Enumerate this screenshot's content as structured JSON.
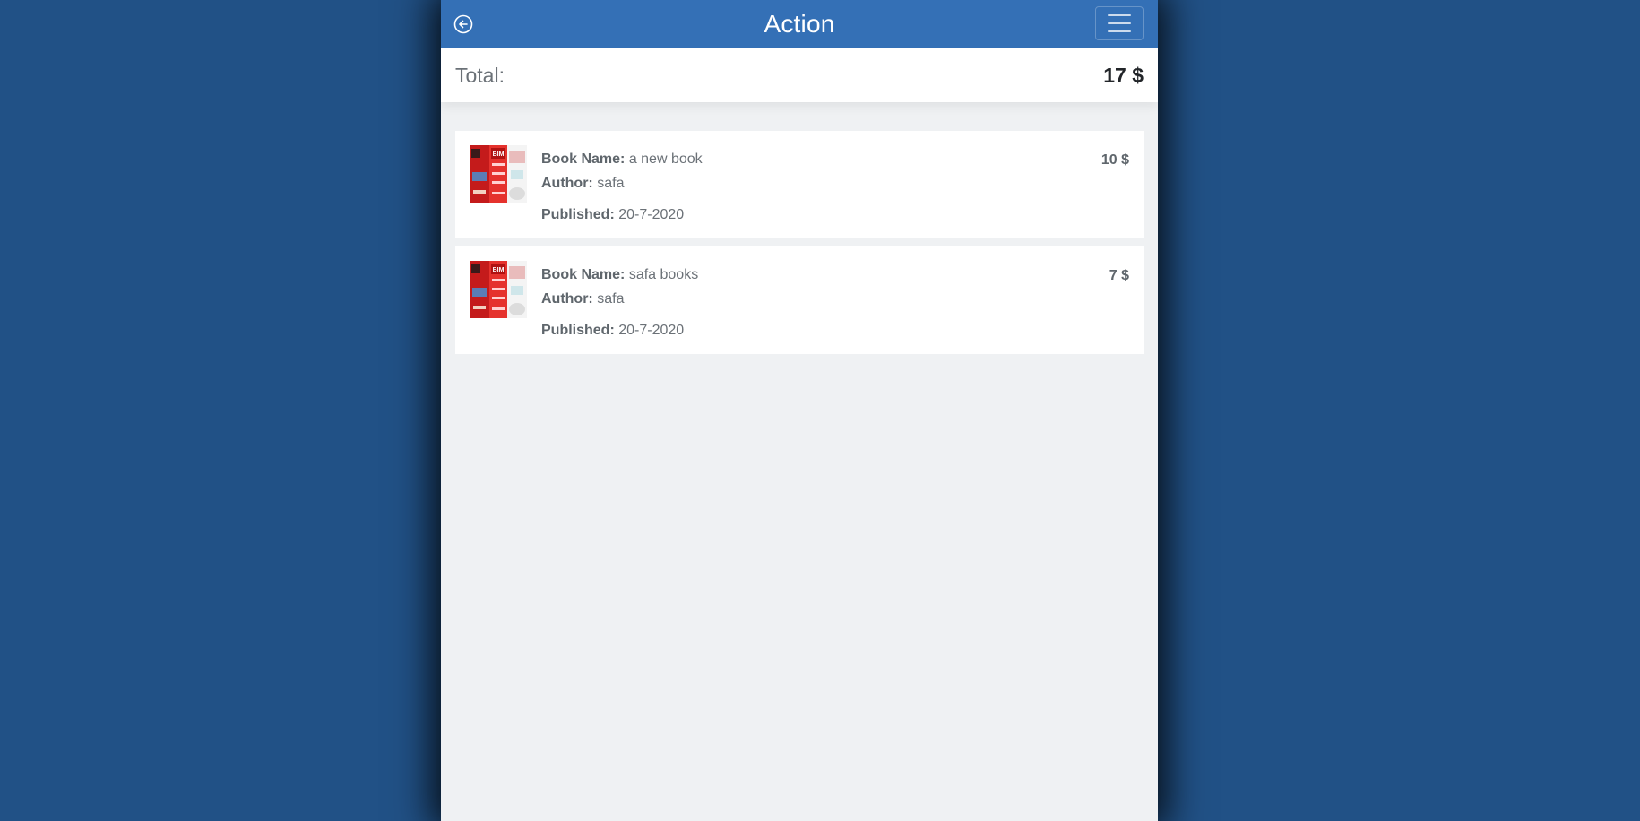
{
  "header": {
    "title": "Action",
    "back_icon": "arrow-left-circle-icon",
    "menu_icon": "hamburger-menu-icon"
  },
  "summary": {
    "total_label": "Total:",
    "total_value": "17 $"
  },
  "books": [
    {
      "name_label": "Book Name:",
      "name": "a new book",
      "author_label": "Author:",
      "author": "safa",
      "published_label": "Published:",
      "published": "20-7-2020",
      "price": "10 $"
    },
    {
      "name_label": "Book Name:",
      "name": "safa books",
      "author_label": "Author:",
      "author": "safa",
      "published_label": "Published:",
      "published": "20-7-2020",
      "price": "7 $"
    }
  ],
  "colors": {
    "page_background": "#215186",
    "header_background": "#3470b6",
    "content_background": "#eff1f3"
  }
}
